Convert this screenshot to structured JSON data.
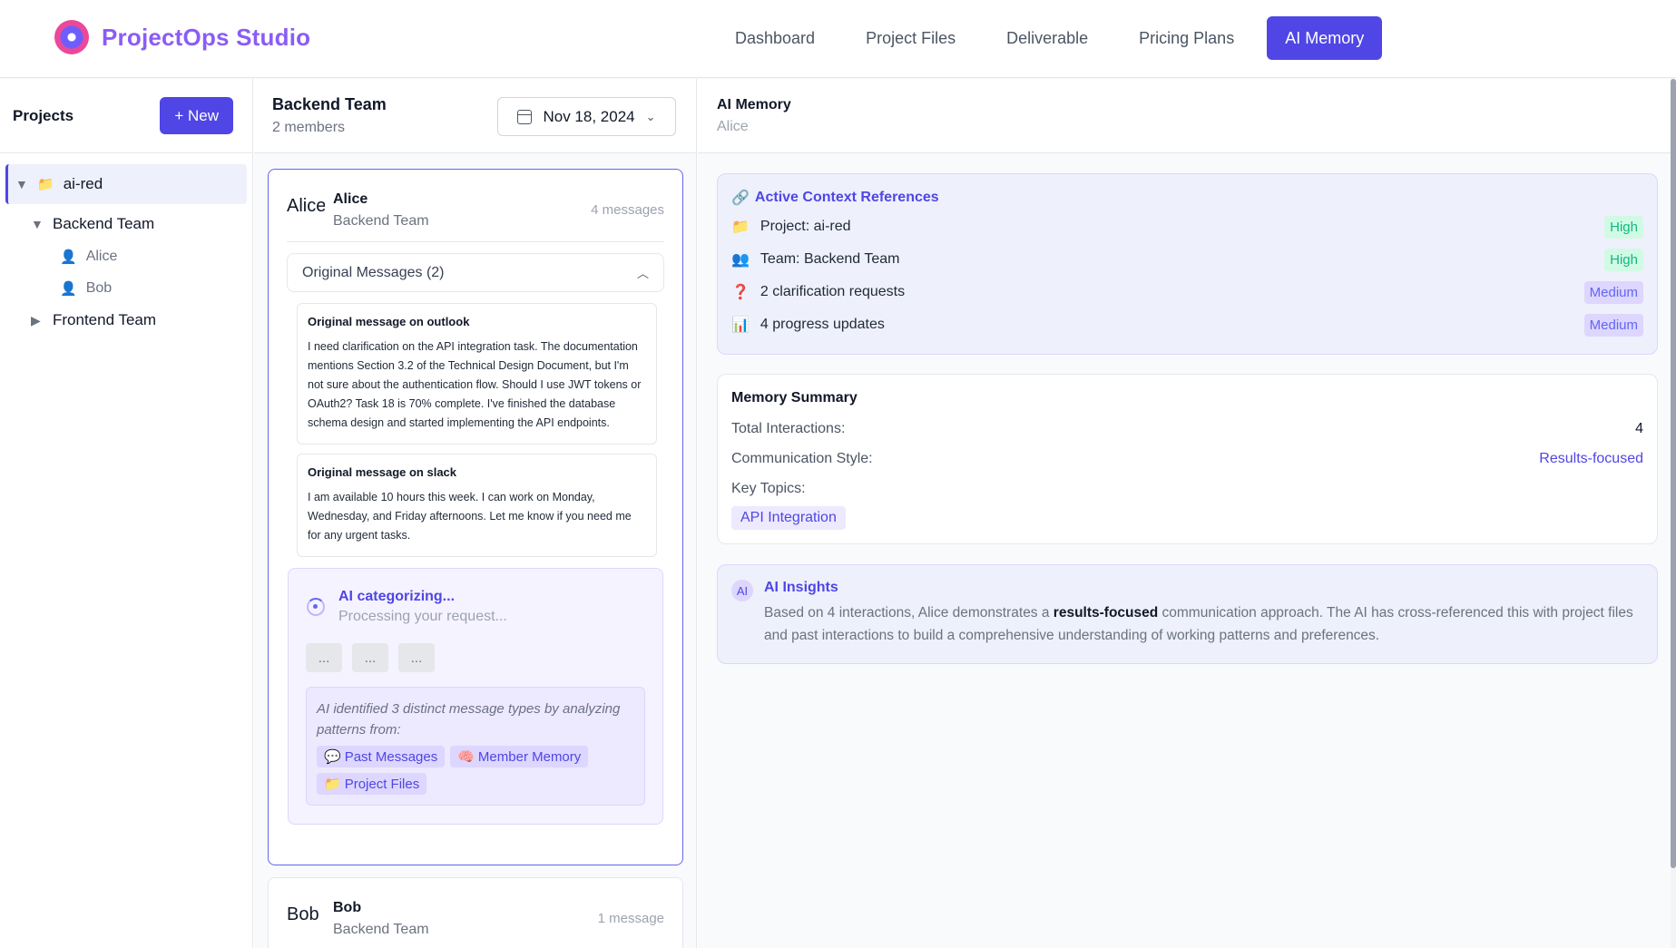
{
  "brand": {
    "name": "ProjectOps Studio"
  },
  "nav": {
    "tabs": [
      "Dashboard",
      "Project Files",
      "Deliverable",
      "Pricing Plans",
      "AI Memory"
    ]
  },
  "sidebar": {
    "title": "Projects",
    "new_label": "+ New",
    "project": "ai-red",
    "teams": [
      {
        "name": "Backend Team",
        "members": [
          "Alice",
          "Bob"
        ]
      },
      {
        "name": "Frontend Team"
      }
    ]
  },
  "middle": {
    "team": "Backend Team",
    "members_count": "2 members",
    "date": "Nov 18, 2024",
    "alice": {
      "avatar": "Alice",
      "name": "Alice",
      "team": "Backend Team",
      "count": "4 messages",
      "originals_label": "Original Messages (2)",
      "messages": [
        {
          "source": "Original message on outlook",
          "body": "I need clarification on the API integration task. The documentation mentions Section 3.2 of the Technical Design Document, but I'm not sure about the authentication flow. Should I use JWT tokens or OAuth2? Task 18 is 70% complete. I've finished the database schema design and started implementing the API endpoints."
        },
        {
          "source": "Original message on slack",
          "body": "I am available 10 hours this week. I can work on Monday, Wednesday, and Friday afternoons. Let me know if you need me for any urgent tasks."
        }
      ],
      "ai_title": "AI categorizing...",
      "ai_sub": "Processing your request...",
      "pills": [
        "...",
        "...",
        "..."
      ],
      "pattern_text": "AI identified 3 distinct message types by analyzing patterns from:",
      "tags": [
        {
          "icon": "💬",
          "label": "Past Messages"
        },
        {
          "icon": "🧠",
          "label": "Member Memory"
        },
        {
          "icon": "📁",
          "label": "Project Files"
        }
      ]
    },
    "bob": {
      "avatar": "Bob",
      "name": "Bob",
      "team": "Backend Team",
      "count": "1 message"
    }
  },
  "right": {
    "title": "AI Memory",
    "sub": "Alice",
    "context": {
      "title": "Active Context References",
      "rows": [
        {
          "icon": "📁",
          "label": "Project: ai-red",
          "level": "High"
        },
        {
          "icon": "👥",
          "label": "Team: Backend Team",
          "level": "High"
        },
        {
          "icon": "❓",
          "label": "2 clarification requests",
          "level": "Medium"
        },
        {
          "icon": "📊",
          "label": "4 progress updates",
          "level": "Medium"
        }
      ]
    },
    "summary": {
      "title": "Memory Summary",
      "interactions_label": "Total Interactions:",
      "interactions_value": "4",
      "style_label": "Communication Style:",
      "style_value": "Results-focused",
      "topics_label": "Key Topics:",
      "topic": "API Integration"
    },
    "insights": {
      "icon": "AI",
      "title": "AI Insights",
      "pre": "Based on 4 interactions, Alice demonstrates a ",
      "bold": "results-focused",
      "post": " communication approach. The AI has cross-referenced this with project files and past interactions to build a comprehensive understanding of working patterns and preferences."
    }
  },
  "colors": {
    "accent": "#4f46e5",
    "high": "#10b981",
    "medium": "#6366f1"
  }
}
